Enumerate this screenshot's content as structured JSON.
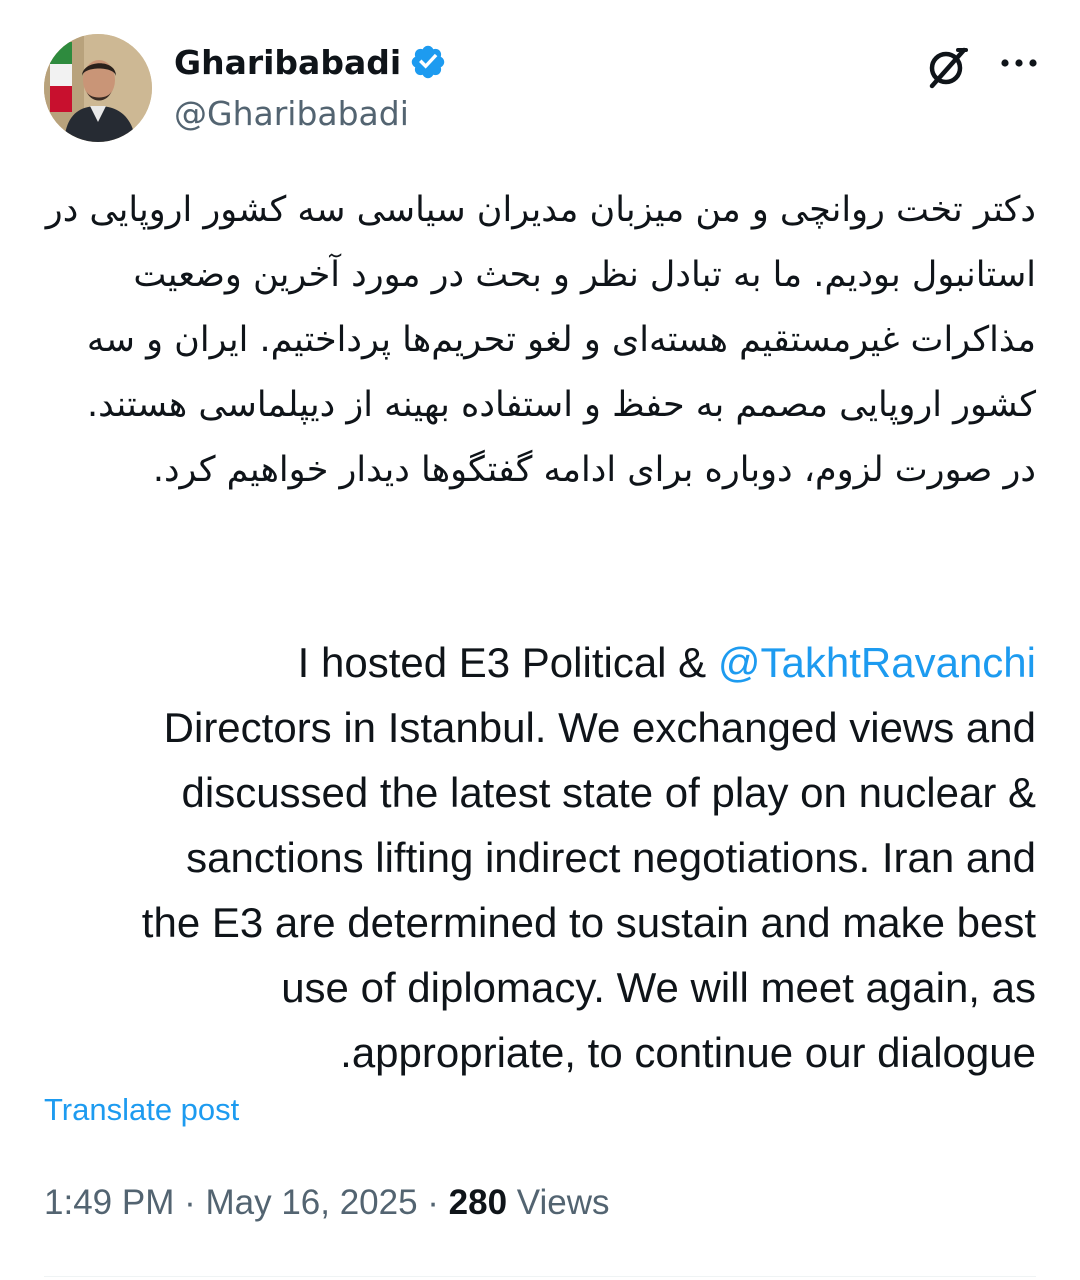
{
  "author": {
    "display_name": "Gharibabadi",
    "handle": "@Gharibabadi",
    "verified": true,
    "avatar_icon": "profile-photo"
  },
  "header_icons": {
    "grok": "grok-icon",
    "more": "more-icon"
  },
  "post": {
    "text_fa": "دکتر تخت روانچی و من میزبان مدیران سیاسی سه کشور اروپایی در استانبول بودیم. ما به تبادل نظر و بحث در مورد آخرین وضعیت مذاکرات غیرمستقیم هسته‌ای و لغو تحریم‌ها پرداختیم. ایران و سه کشور اروپایی مصمم به حفظ و استفاده بهینه از دیپلماسی هستند. در صورت لزوم، دوباره برای ادامه گفتگوها دیدار خواهیم کرد.",
    "text_en_lines": [
      "I hosted E3 Political & ",
      "Directors in Istanbul. We exchanged views and",
      "discussed the latest state of play on nuclear &",
      "sanctions lifting indirect negotiations. Iran and",
      "the E3 are determined to sustain and make best",
      "use of diplomacy. We will meet again, as",
      ".appropriate, to continue our dialogue"
    ],
    "mention": "@TakhtRavanchi"
  },
  "translate_label": "Translate post",
  "meta": {
    "time": "1:49 PM",
    "separator": " · ",
    "date": "May 16, 2025",
    "views_count": "280",
    "views_label": " Views"
  },
  "colors": {
    "link": "#1d9bf0",
    "secondary": "#536471",
    "text": "#0f1419"
  }
}
